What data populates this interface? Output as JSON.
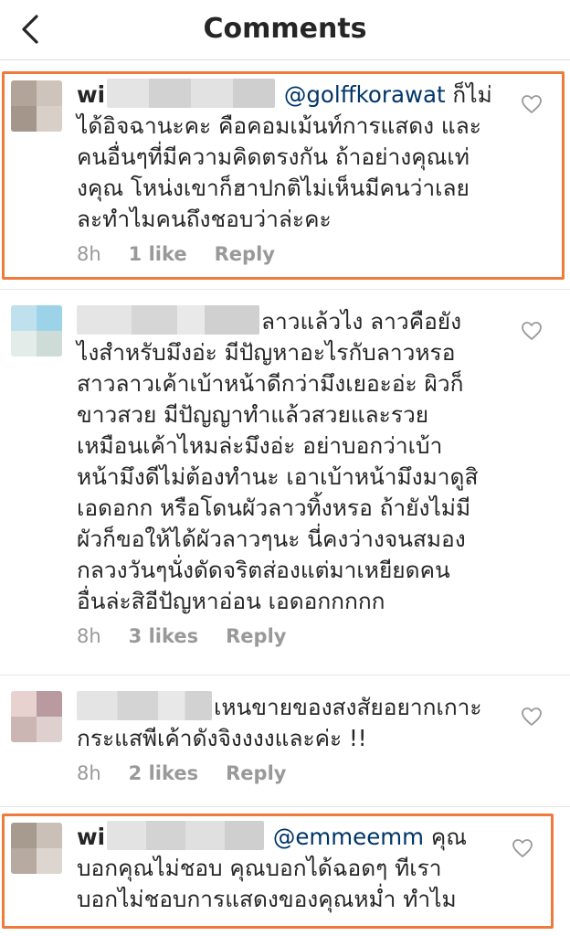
{
  "header": {
    "title": "Comments"
  },
  "comments": [
    {
      "username": "wi",
      "mention": "@golffkorawat",
      "lines": [
        "ก็ไม่",
        "ได้อิจฉานะคะ คือคอมเม้นท์การแสดง และ",
        "คนอื่นๆที่มีความคิดตรงกัน ถ้าอย่างคุณเท่",
        "งคุณ โหน่งเขาก็ฮาปกติไม่เห็นมีคนว่าเลย",
        "ละทำไมคนถึงชอบว่าล่ะคะ"
      ],
      "time": "8h",
      "likes": "1 like",
      "reply": "Reply"
    },
    {
      "username": "",
      "mention": "",
      "lines": [
        "ลาวแล้วไง ลาวคือยัง",
        "ไงสำหรับมึงอ่ะ  มีปัญหาอะไรกับลาวหรอ",
        "สาวลาวเค้าเบ้าหน้าดีกว่ามึงเยอะอ่ะ ผิวก็",
        "ขาวสวย มีปัญญาทำแล้วสวยและรวย",
        "เหมือนเค้าไหมล่ะมึงอ่ะ อย่าบอกว่าเบ้า",
        "หน้ามึงดีไม่ต้องทำนะ เอาเบ้าหน้ามึงมาดูสิ",
        "เอดอกก หรือโดนผัวลาวทิ้งหรอ ถ้ายังไม่มี",
        "ผัวก็ขอให้ได้ผัวลาวๆนะ นี่คงว่างจนสมอง",
        "กลวงวันๆนั่งดัดจริตส่องแต่มาเหยียดคน",
        "อื่นล่ะสิอีปัญหาอ่อน เอดอกกกกก"
      ],
      "time": "8h",
      "likes": "3 likes",
      "reply": "Reply"
    },
    {
      "username": "",
      "mention": "",
      "lines": [
        "เหนขายของสงสัยอยากเกาะ",
        "กระแสพีเค้าดังจิงงงงและค่ะ !!"
      ],
      "time": "8h",
      "likes": "2 likes",
      "reply": "Reply"
    },
    {
      "username": "wi",
      "mention": "@emmeemm",
      "lines": [
        "คุณ",
        "บอกคุณไม่ชอบ คุณบอกได้ฉอดๆ ทีเรา",
        "บอกไม่ชอบการแสดงของคุณหม่ำ ทำไม"
      ],
      "time": "",
      "likes": "",
      "reply": ""
    }
  ],
  "colors": {
    "highlight": "#ef7a3b",
    "mention": "#003569",
    "meta": "#999999"
  },
  "icons": {
    "back": "chevron-left-icon",
    "like": "heart-outline-icon"
  }
}
